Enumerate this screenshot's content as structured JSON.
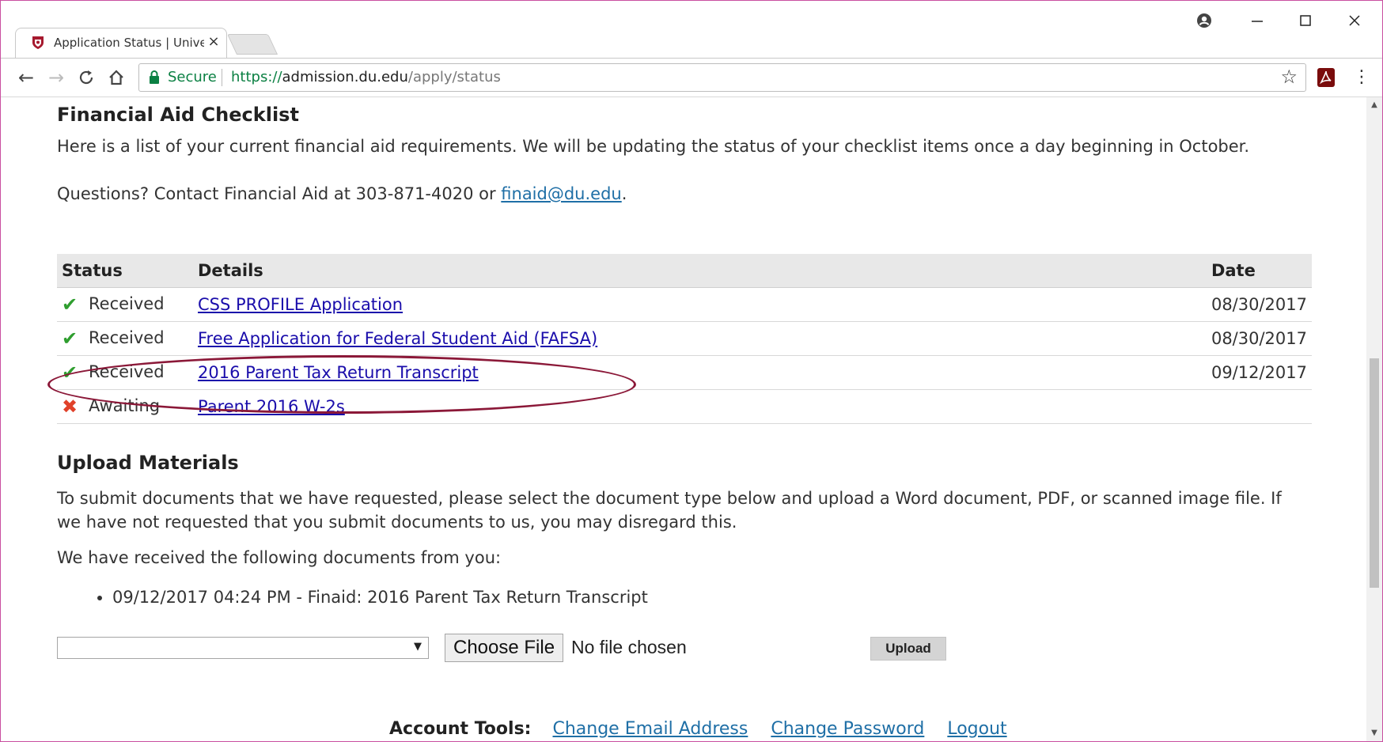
{
  "browser": {
    "tab_title": "Application Status | Unive",
    "tab_close": "×",
    "secure_label": "Secure",
    "url_scheme": "https://",
    "url_host": "admission.du.edu",
    "url_path": "/apply/status"
  },
  "financial_aid": {
    "title": "Financial Aid Checklist",
    "intro": "Here is a list of your current financial aid requirements. We will be updating the status of your checklist items once a day beginning in October.",
    "questions_prefix": "Questions? Contact Financial Aid at 303-871-4020 or ",
    "email": "finaid@du.edu",
    "questions_suffix": ".",
    "columns": {
      "status": "Status",
      "details": "Details",
      "date": "Date"
    },
    "rows": [
      {
        "status": "Received",
        "icon": "check-icon",
        "details": "CSS PROFILE Application",
        "date": "08/30/2017"
      },
      {
        "status": "Received",
        "icon": "check-icon",
        "details": "Free Application for Federal Student Aid (FAFSA)",
        "date": "08/30/2017"
      },
      {
        "status": "Received",
        "icon": "check-icon",
        "details": "2016 Parent Tax Return Transcript",
        "date": "09/12/2017"
      },
      {
        "status": "Awaiting",
        "icon": "cross-icon",
        "details": "Parent 2016 W-2s",
        "date": ""
      }
    ]
  },
  "upload": {
    "title": "Upload Materials",
    "description": "To submit documents that we have requested, please select the document type below and upload a Word document, PDF, or scanned image file. If we have not requested that you submit documents to us, you may disregard this.",
    "received_label": "We have received the following documents from you:",
    "received_docs": [
      "09/12/2017 04:24 PM - Finaid: 2016 Parent Tax Return Transcript"
    ],
    "select_value": "",
    "choose_file_label": "Choose File",
    "file_status": "No file chosen",
    "upload_label": "Upload"
  },
  "account_tools": {
    "label": "Account Tools:",
    "links": [
      "Change Email Address",
      "Change Password",
      "Logout"
    ]
  },
  "colors": {
    "annotation_ellipse": "#8b1838",
    "check": "#2f9e2f",
    "cross": "#e0412a",
    "link": "#1a0dab"
  }
}
